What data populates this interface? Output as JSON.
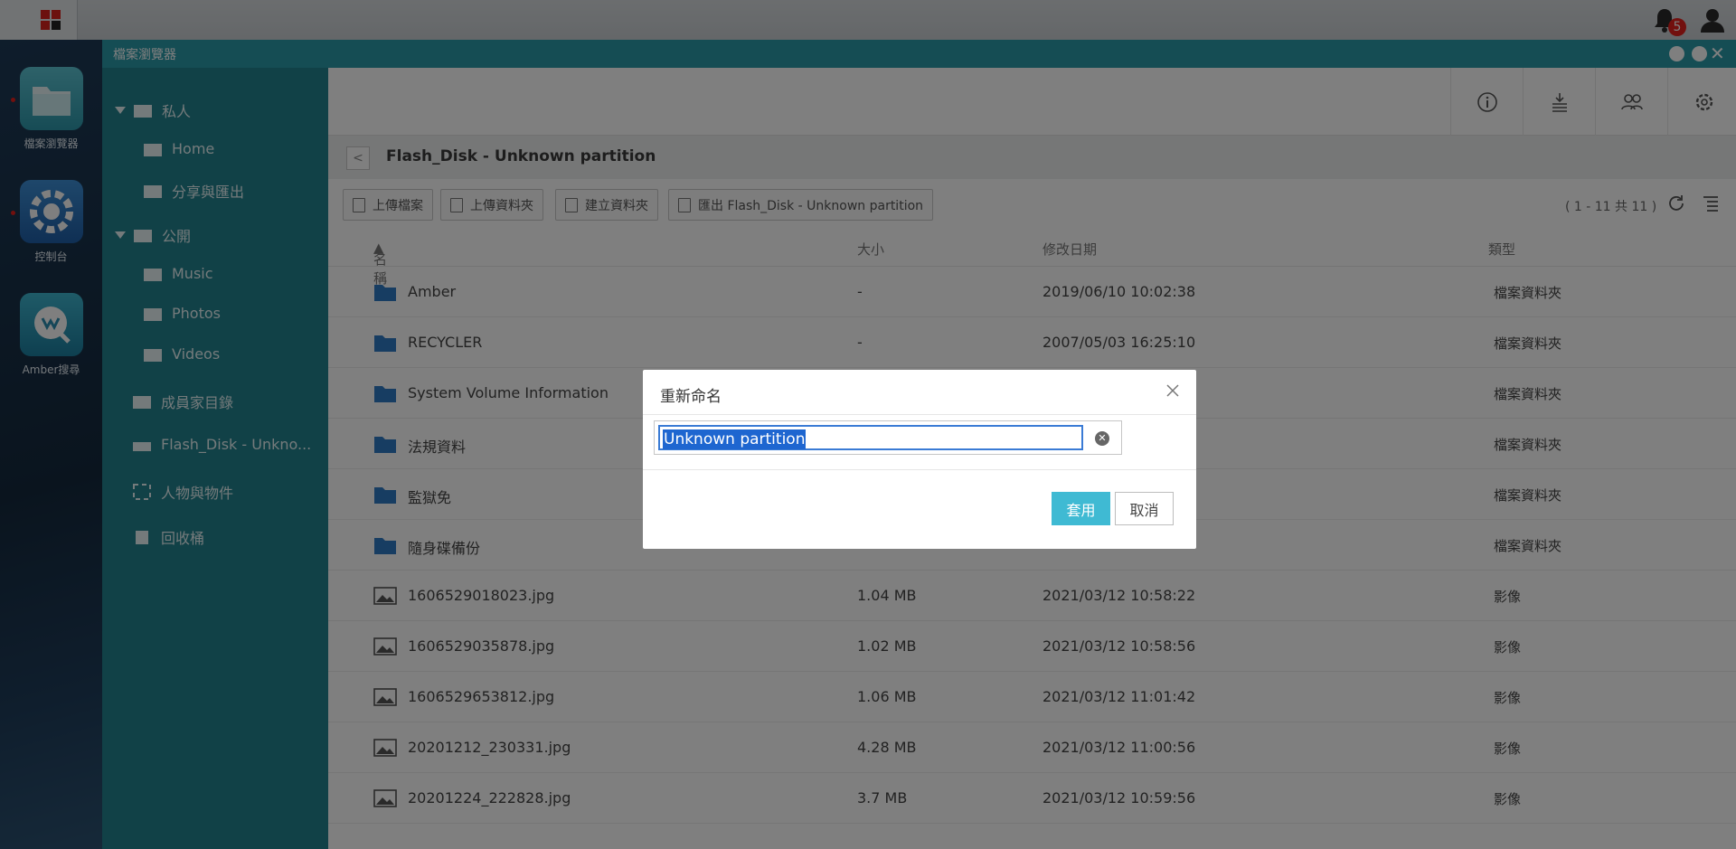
{
  "taskbar": {
    "notification_count": "5"
  },
  "desktop": {
    "apps": [
      {
        "label": "檔案瀏覽器",
        "icon": "folder-app-icon"
      },
      {
        "label": "控制台",
        "icon": "gear-app-icon"
      },
      {
        "label": "Amber搜尋",
        "icon": "search-app-icon"
      }
    ]
  },
  "window": {
    "title": "檔案瀏覽器",
    "sidebar": {
      "private": "私人",
      "home": "Home",
      "share": "分享與匯出",
      "public": "公開",
      "music": "Music",
      "photos": "Photos",
      "videos": "Videos",
      "member": "成員家目錄",
      "flash": "Flash_Disk - Unkno...",
      "people": "人物與物件",
      "recycle": "回收桶"
    },
    "breadcrumb": "Flash_Disk - Unknown partition",
    "actions": {
      "upload_file": "上傳檔案",
      "upload_folder": "上傳資料夾",
      "new_folder": "建立資料夾",
      "export": "匯出 Flash_Disk - Unknown partition"
    },
    "count": "( 1 - 11 共 11 )",
    "columns": {
      "name": "名稱",
      "size": "大小",
      "date": "修改日期",
      "type": "類型"
    },
    "rows": [
      {
        "name": "Amber",
        "size": "-",
        "date": "2019/06/10 10:02:38",
        "type": "檔案資料夾",
        "kind": "folder"
      },
      {
        "name": "RECYCLER",
        "size": "-",
        "date": "2007/05/03 16:25:10",
        "type": "檔案資料夾",
        "kind": "folder"
      },
      {
        "name": "System Volume Information",
        "size": "",
        "date": "",
        "type": "檔案資料夾",
        "kind": "folder"
      },
      {
        "name": "法規資料",
        "size": "",
        "date": "",
        "type": "檔案資料夾",
        "kind": "folder"
      },
      {
        "name": "監獄免",
        "size": "",
        "date": "",
        "type": "檔案資料夾",
        "kind": "folder"
      },
      {
        "name": "隨身碟備份",
        "size": "",
        "date": "",
        "type": "檔案資料夾",
        "kind": "folder"
      },
      {
        "name": "1606529018023.jpg",
        "size": "1.04 MB",
        "date": "2021/03/12 10:58:22",
        "type": "影像",
        "kind": "image"
      },
      {
        "name": "1606529035878.jpg",
        "size": "1.02 MB",
        "date": "2021/03/12 10:58:56",
        "type": "影像",
        "kind": "image"
      },
      {
        "name": "1606529653812.jpg",
        "size": "1.06 MB",
        "date": "2021/03/12 11:01:42",
        "type": "影像",
        "kind": "image"
      },
      {
        "name": "20201212_230331.jpg",
        "size": "4.28 MB",
        "date": "2021/03/12 11:00:56",
        "type": "影像",
        "kind": "image"
      },
      {
        "name": "20201224_222828.jpg",
        "size": "3.7 MB",
        "date": "2021/03/12 10:59:56",
        "type": "影像",
        "kind": "image"
      }
    ]
  },
  "dialog": {
    "title": "重新命名",
    "value": "Unknown partition",
    "apply": "套用",
    "cancel": "取消"
  },
  "colors": {
    "titlebar": "#2b9aa9",
    "sidebar": "#22838f",
    "apply": "#3fbad3"
  }
}
